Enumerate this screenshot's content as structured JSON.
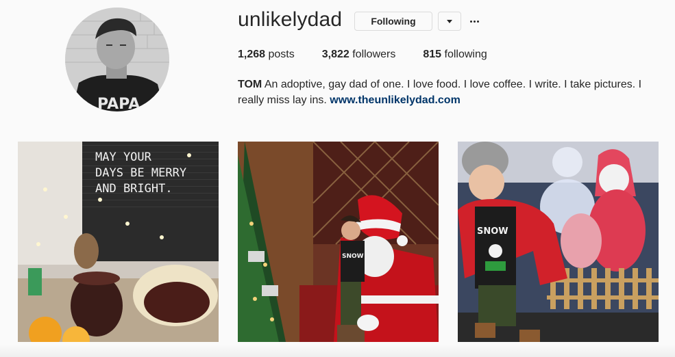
{
  "profile": {
    "username": "unlikelydad",
    "following_button": "Following",
    "dropdown_icon": "chevron-down-icon",
    "more_icon": "more-options-icon"
  },
  "stats": {
    "posts_count": "1,268",
    "posts_label": " posts",
    "followers_count": "3,822",
    "followers_label": " followers",
    "following_count": "815",
    "following_label": " following"
  },
  "bio": {
    "name": "TOM",
    "text": " An adoptive, gay dad of one. I love food. I love coffee. I write. I take pictures. I really miss lay ins. ",
    "website": "www.theunlikelydad.com"
  },
  "posts": [
    {
      "letterboard_line1": "MAY YOUR",
      "letterboard_line2": "DAYS BE MERRY",
      "letterboard_line3": "AND BRIGHT."
    },
    {
      "shirt_text": "SNOW"
    },
    {
      "shirt_text": "SNOW"
    }
  ],
  "colors": {
    "link": "#003569",
    "text": "#262626",
    "border": "#dbdbdb",
    "background": "#fafafa"
  }
}
